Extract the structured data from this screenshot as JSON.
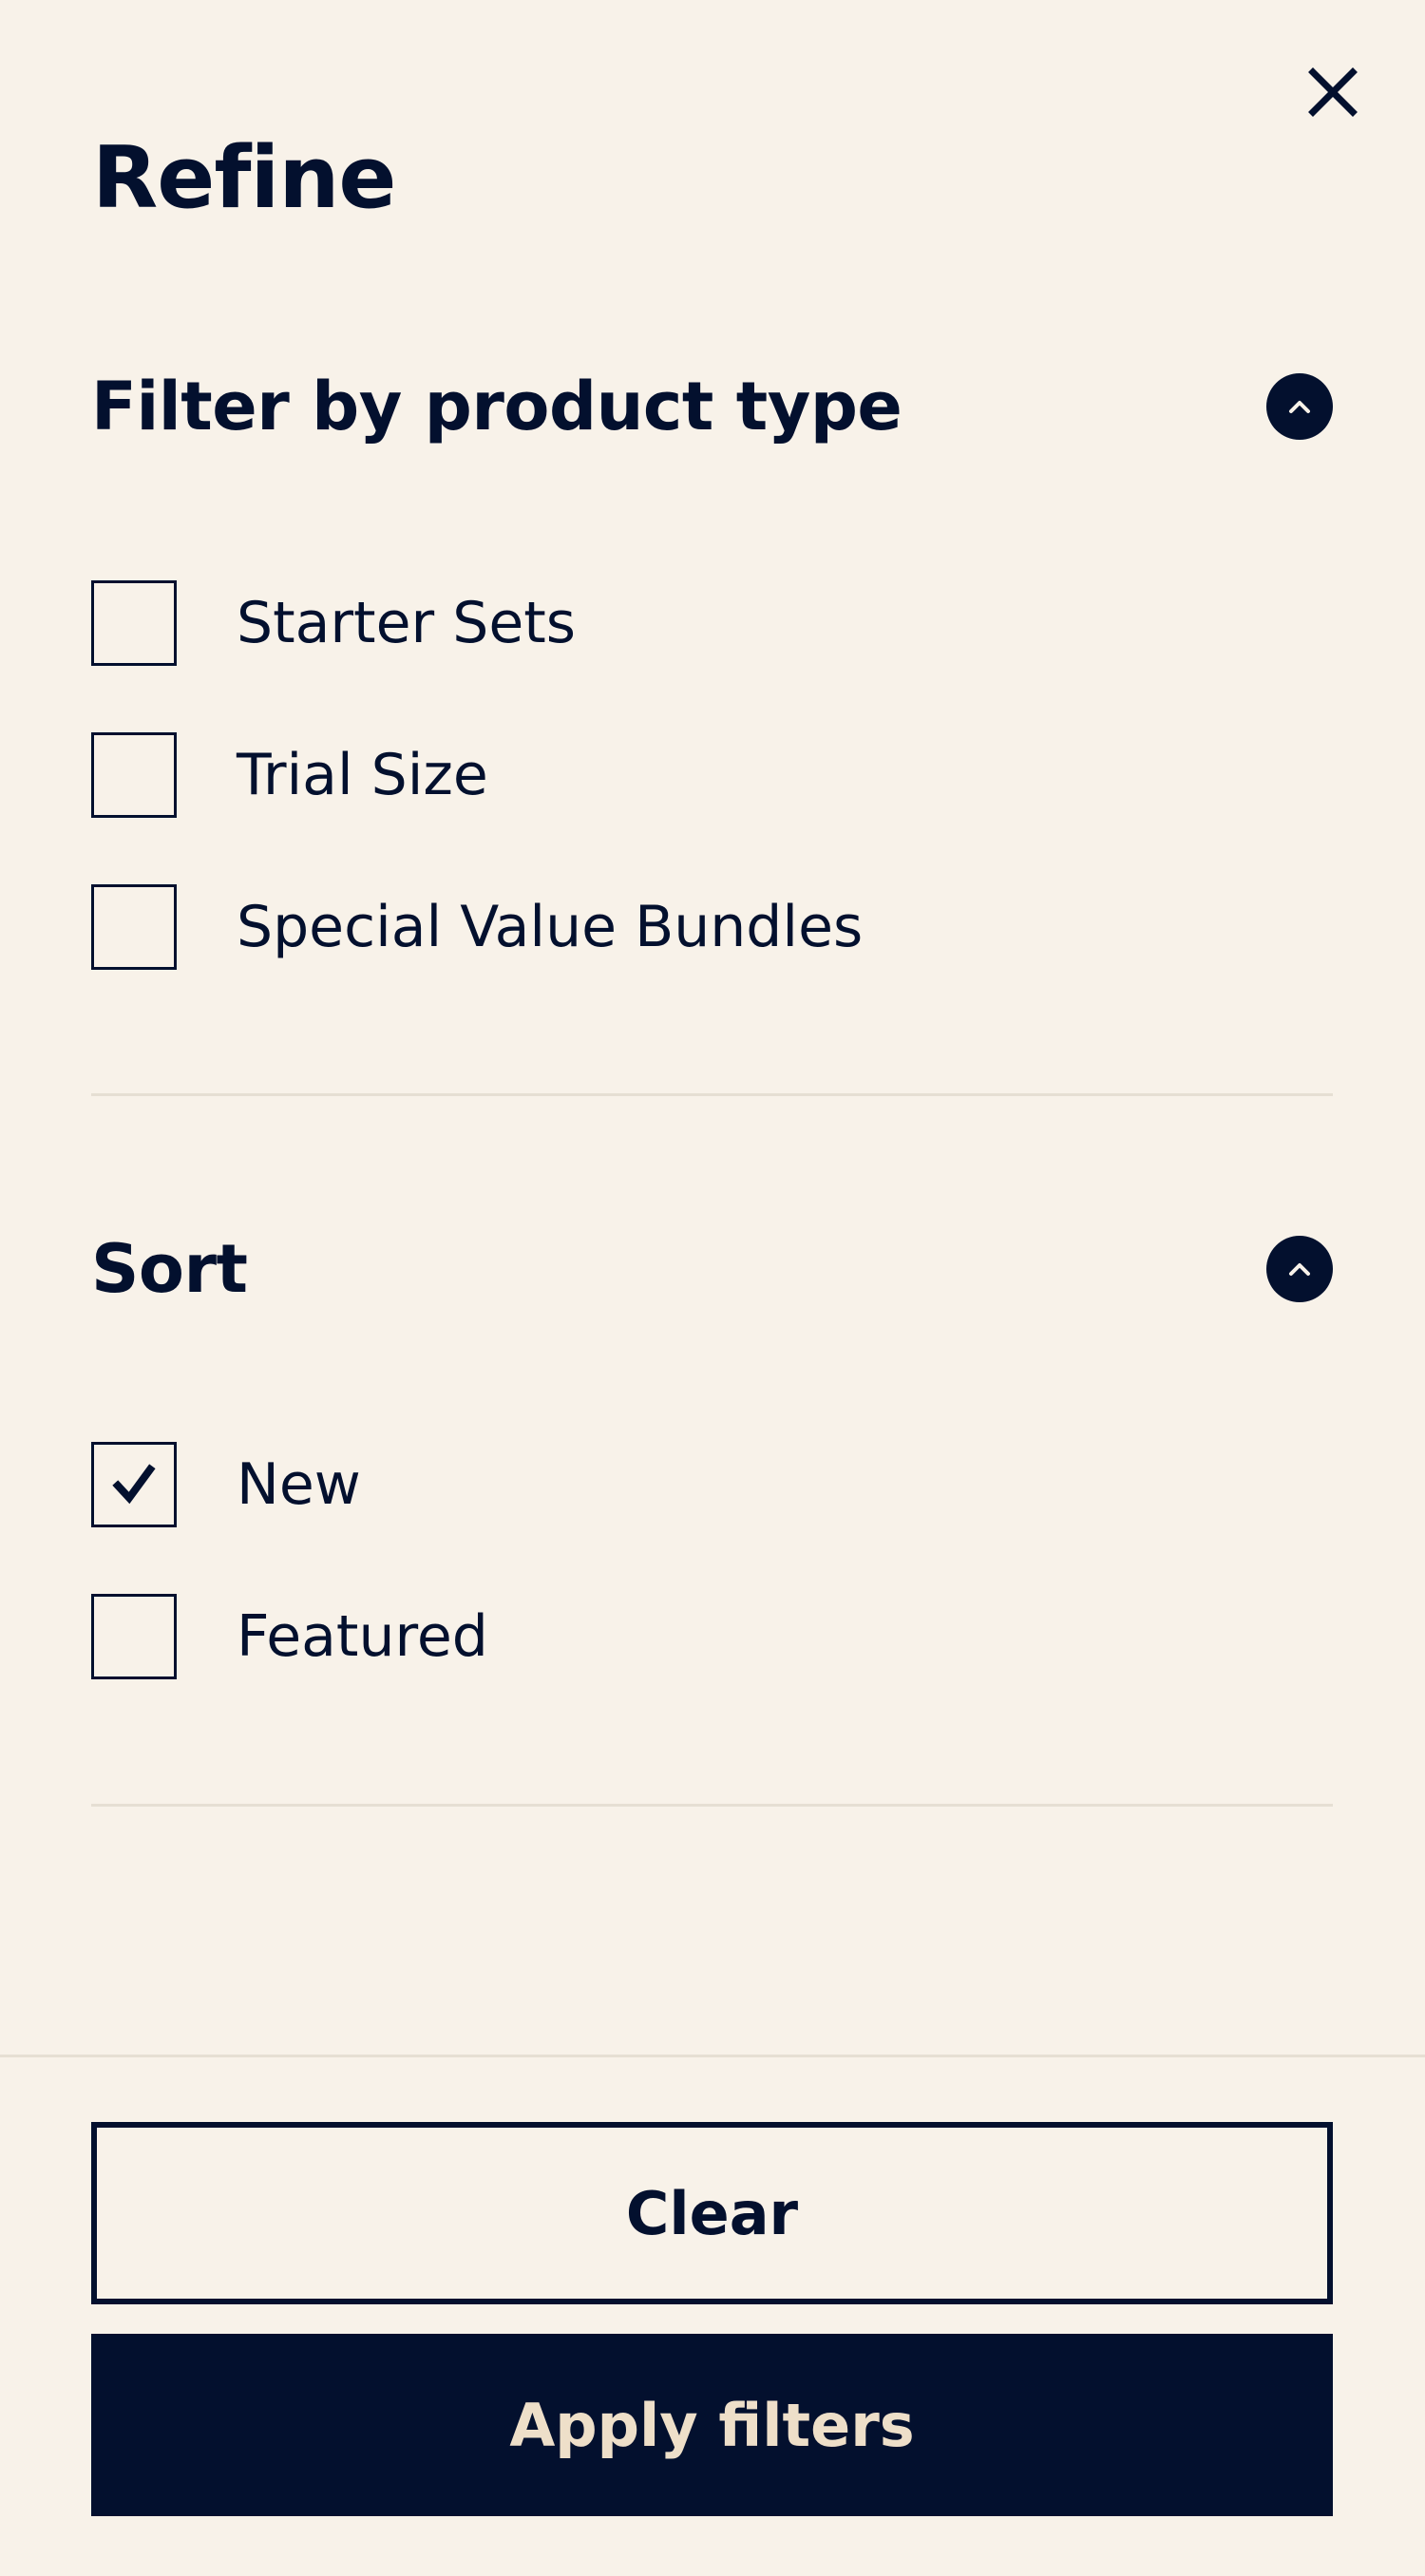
{
  "header": {
    "title": "Refine",
    "close_icon": "close-icon"
  },
  "sections": [
    {
      "title": "Filter by product type",
      "expanded": true,
      "toggle_icon": "chevron-up-icon",
      "options": [
        {
          "label": "Starter Sets",
          "checked": false
        },
        {
          "label": "Trial Size",
          "checked": false
        },
        {
          "label": "Special Value Bundles",
          "checked": false
        }
      ]
    },
    {
      "title": "Sort",
      "expanded": true,
      "toggle_icon": "chevron-up-icon",
      "options": [
        {
          "label": "New",
          "checked": true
        },
        {
          "label": "Featured",
          "checked": false
        }
      ]
    }
  ],
  "footer": {
    "clear_label": "Clear",
    "apply_label": "Apply filters"
  },
  "colors": {
    "background": "#F8F2E9",
    "primary": "#03102E",
    "apply_text": "#EEDFC9",
    "divider": "#E6DFD3"
  }
}
